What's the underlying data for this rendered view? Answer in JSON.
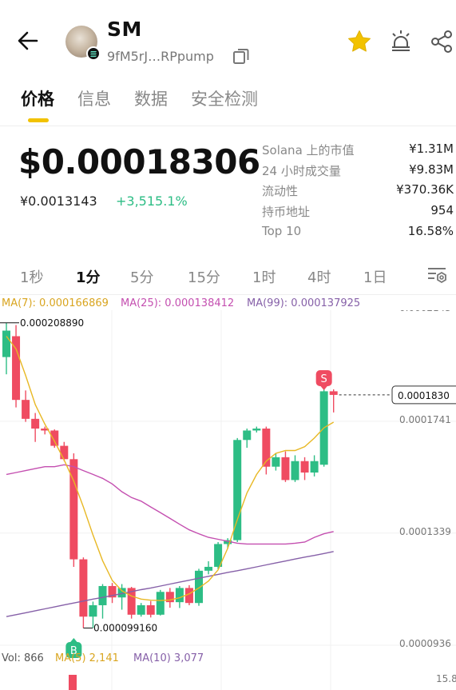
{
  "header": {
    "title": "SM",
    "address": "9fM5rJ…RPpump"
  },
  "tabs": [
    "价格",
    "信息",
    "数据",
    "安全检测"
  ],
  "price": {
    "usd": "$0.00018306",
    "cny": "¥0.0013143",
    "change": "+3,515.1%"
  },
  "stats": [
    {
      "label": "Solana 上的市值",
      "value": "¥1.31M"
    },
    {
      "label": "24 小时成交量",
      "value": "¥9.83M"
    },
    {
      "label": "流动性",
      "value": "¥370.36K"
    },
    {
      "label": "持币地址",
      "value": "954"
    },
    {
      "label": "Top 10",
      "value": "16.58%"
    }
  ],
  "intervals": [
    "1秒",
    "1分",
    "5分",
    "15分",
    "1时",
    "4时",
    "1日"
  ],
  "ma": {
    "ma7": "MA(7): 0.000166869",
    "ma25": "MA(25): 0.000138412",
    "ma99": "MA(99): 0.000137925"
  },
  "volume": {
    "vol": "Vol: 866",
    "ma5": "MA(5) 2,141",
    "ma10": "MA(10) 3,077",
    "axis_label": "15.8"
  },
  "colors": {
    "up": "#2dbd85",
    "down": "#ef4b61",
    "ma7": "#e8b824",
    "ma25": "#c44fb0",
    "ma99": "#8660a8",
    "accent": "#f2c200"
  },
  "chart_data": {
    "type": "candlestick",
    "y_tick_labels": [
      "0.0002143",
      "0.0001741",
      "0.0001339",
      "0.0000936"
    ],
    "ylim": [
      9.36e-05,
      0.0002143
    ],
    "current_price_label": "0.0001830",
    "high_label": "0.000208890",
    "low_label": "0.000099160",
    "markers": [
      {
        "text": "B",
        "candle_index": 7
      },
      {
        "text": "S",
        "candle_index": 33
      }
    ],
    "candles": [
      {
        "o": 0.0001966,
        "h": 0.0002089,
        "l": 0.0001904,
        "c": 0.0002061
      },
      {
        "o": 0.0002041,
        "h": 0.0002081,
        "l": 0.0001785,
        "c": 0.0001812
      },
      {
        "o": 0.0001812,
        "h": 0.0001846,
        "l": 0.0001733,
        "c": 0.0001744
      },
      {
        "o": 0.0001744,
        "h": 0.0001765,
        "l": 0.0001661,
        "c": 0.0001709
      },
      {
        "o": 0.0001709,
        "h": 0.0001716,
        "l": 0.0001688,
        "c": 0.0001702
      },
      {
        "o": 0.0001702,
        "h": 0.0001706,
        "l": 0.000164,
        "c": 0.0001647
      },
      {
        "o": 0.0001647,
        "h": 0.0001661,
        "l": 0.0001592,
        "c": 0.0001599
      },
      {
        "o": 0.0001599,
        "h": 0.000162,
        "l": 0.0001212,
        "c": 0.0001239
      },
      {
        "o": 0.0001239,
        "h": 0.0001246,
        "l": 9.92e-05,
        "c": 0.0001033
      },
      {
        "o": 0.0001033,
        "h": 0.0001087,
        "l": 9.92e-05,
        "c": 0.0001074
      },
      {
        "o": 0.0001074,
        "h": 0.000115,
        "l": 0.0001026,
        "c": 0.0001143
      },
      {
        "o": 0.0001143,
        "h": 0.0001154,
        "l": 0.0001082,
        "c": 0.0001102
      },
      {
        "o": 0.0001102,
        "h": 0.000115,
        "l": 0.0001058,
        "c": 0.0001136
      },
      {
        "o": 0.0001136,
        "h": 0.000114,
        "l": 0.0001026,
        "c": 0.000104
      },
      {
        "o": 0.000104,
        "h": 0.0001082,
        "l": 0.0001033,
        "c": 0.0001074
      },
      {
        "o": 0.0001074,
        "h": 0.0001089,
        "l": 0.000103,
        "c": 0.000104
      },
      {
        "o": 0.000104,
        "h": 0.0001129,
        "l": 0.0001037,
        "c": 0.0001122
      },
      {
        "o": 0.0001122,
        "h": 0.0001136,
        "l": 0.0001065,
        "c": 0.0001085
      },
      {
        "o": 0.0001085,
        "h": 0.0001143,
        "l": 0.0001064,
        "c": 0.0001136
      },
      {
        "o": 0.0001136,
        "h": 0.0001146,
        "l": 0.0001074,
        "c": 0.0001082
      },
      {
        "o": 0.0001082,
        "h": 0.0001205,
        "l": 0.0001072,
        "c": 0.0001198
      },
      {
        "o": 0.0001198,
        "h": 0.0001232,
        "l": 0.0001185,
        "c": 0.0001212
      },
      {
        "o": 0.0001212,
        "h": 0.0001301,
        "l": 0.0001204,
        "c": 0.0001294
      },
      {
        "o": 0.0001294,
        "h": 0.0001315,
        "l": 0.0001277,
        "c": 0.0001308
      },
      {
        "o": 0.0001308,
        "h": 0.0001675,
        "l": 0.0001301,
        "c": 0.0001668
      },
      {
        "o": 0.0001668,
        "h": 0.0001709,
        "l": 0.000164,
        "c": 0.0001702
      },
      {
        "o": 0.0001702,
        "h": 0.0001716,
        "l": 0.0001695,
        "c": 0.0001709
      },
      {
        "o": 0.0001709,
        "h": 0.0001716,
        "l": 0.0001544,
        "c": 0.0001572
      },
      {
        "o": 0.0001572,
        "h": 0.000162,
        "l": 0.0001558,
        "c": 0.0001606
      },
      {
        "o": 0.0001606,
        "h": 0.0001627,
        "l": 0.0001517,
        "c": 0.0001524
      },
      {
        "o": 0.0001524,
        "h": 0.0001613,
        "l": 0.0001517,
        "c": 0.0001592
      },
      {
        "o": 0.0001592,
        "h": 0.0001606,
        "l": 0.0001524,
        "c": 0.0001551
      },
      {
        "o": 0.0001551,
        "h": 0.0001613,
        "l": 0.0001537,
        "c": 0.0001592
      },
      {
        "o": 0.0001579,
        "h": 0.000186,
        "l": 0.0001572,
        "c": 0.0001843
      },
      {
        "o": 0.0001843,
        "h": 0.000185,
        "l": 0.0001767,
        "c": 0.000183
      }
    ],
    "ma7": [
      0.0002041,
      0.0001995,
      0.00019,
      0.0001795,
      0.0001725,
      0.0001663,
      0.0001596,
      0.000152,
      0.0001427,
      0.0001326,
      0.0001234,
      0.0001163,
      0.0001126,
      0.0001107,
      0.0001096,
      0.0001092,
      0.0001091,
      0.0001093,
      0.0001101,
      0.0001115,
      0.0001136,
      0.0001161,
      0.0001201,
      0.0001279,
      0.0001382,
      0.0001478,
      0.0001544,
      0.0001592,
      0.000162,
      0.000163,
      0.000163,
      0.0001644,
      0.0001675,
      0.0001712,
      0.0001732
    ],
    "ma25": [
      0.0001544,
      0.0001551,
      0.0001558,
      0.0001565,
      0.0001572,
      0.0001572,
      0.0001579,
      0.0001572,
      0.0001558,
      0.0001544,
      0.000153,
      0.000151,
      0.0001482,
      0.0001461,
      0.0001448,
      0.0001427,
      0.0001407,
      0.0001386,
      0.0001365,
      0.0001345,
      0.0001331,
      0.0001318,
      0.0001311,
      0.0001304,
      0.0001297,
      0.0001294,
      0.0001294,
      0.0001294,
      0.0001294,
      0.0001294,
      0.0001297,
      0.0001301,
      0.0001318,
      0.0001331,
      0.0001339
    ],
    "ma99": [
      0.0001033,
      0.000104,
      0.0001047,
      0.0001054,
      0.0001061,
      0.0001068,
      0.0001075,
      0.0001082,
      0.0001089,
      0.0001096,
      0.0001102,
      0.0001109,
      0.0001116,
      0.0001123,
      0.000113,
      0.0001136,
      0.0001143,
      0.000115,
      0.0001157,
      0.0001164,
      0.0001171,
      0.0001178,
      0.0001185,
      0.0001192,
      0.0001198,
      0.0001205,
      0.0001212,
      0.0001219,
      0.0001226,
      0.0001233,
      0.000124,
      0.0001247,
      0.0001253,
      0.000126,
      0.0001267
    ],
    "volume_values": [
      866
    ]
  }
}
